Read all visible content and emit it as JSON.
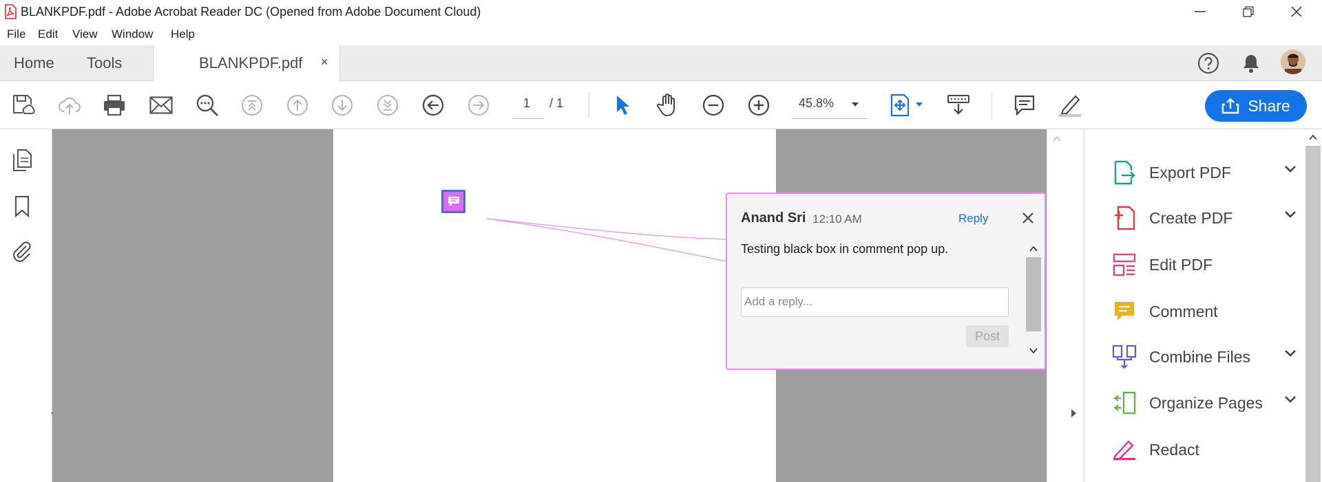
{
  "window": {
    "title": "BLANKPDF.pdf - Adobe Acrobat Reader DC (Opened from Adobe Document Cloud)"
  },
  "menu": [
    "File",
    "Edit",
    "View",
    "Window",
    "Help"
  ],
  "tabs": {
    "home": "Home",
    "tools": "Tools",
    "document": "BLANKPDF.pdf",
    "close_glyph": "×"
  },
  "toolbar": {
    "page_current": "1",
    "page_total": "/ 1",
    "zoom": "45.8%"
  },
  "share": {
    "label": "Share"
  },
  "comment": {
    "author": "Anand Sri",
    "time": "12:10 AM",
    "reply_label": "Reply",
    "text": "Testing black box in comment pop up.",
    "reply_placeholder": "Add a reply...",
    "post_label": "Post"
  },
  "right_pane": {
    "items": [
      {
        "label": "Export PDF",
        "icon": "export-pdf-icon",
        "color": "#1a9f8e"
      },
      {
        "label": "Create PDF",
        "icon": "create-pdf-icon",
        "color": "#e0393e"
      },
      {
        "label": "Edit PDF",
        "icon": "edit-pdf-icon",
        "color": "#e0457b"
      },
      {
        "label": "Comment",
        "icon": "comment-icon",
        "color": "#e8b31b"
      },
      {
        "label": "Combine Files",
        "icon": "combine-files-icon",
        "color": "#6d55d8"
      },
      {
        "label": "Organize Pages",
        "icon": "organize-pages-icon",
        "color": "#62b346"
      },
      {
        "label": "Redact",
        "icon": "redact-icon",
        "color": "#d83790"
      }
    ]
  },
  "colors": {
    "accent": "#1473e6",
    "popup_border": "#ea8fe7",
    "doc_background": "#9e9e9e"
  }
}
